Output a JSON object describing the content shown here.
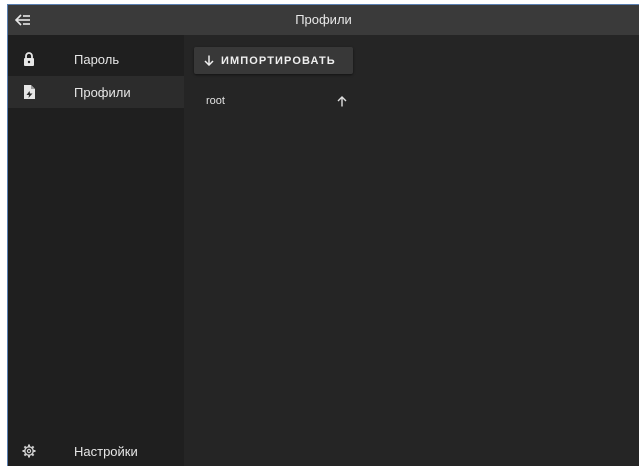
{
  "appbar": {
    "title": "Профили",
    "back_icon": "arrow-collapse-left-icon"
  },
  "sidebar": {
    "items": [
      {
        "label": "Пароль",
        "icon": "lock-icon"
      },
      {
        "label": "Профили",
        "icon": "file-icon",
        "active": true
      }
    ],
    "footer": {
      "label": "Настройки",
      "icon": "gear-icon"
    }
  },
  "main": {
    "import_button": {
      "label": "ИМПОРТИРОВАТЬ",
      "icon": "arrow-down-icon"
    },
    "profiles": [
      {
        "name": "root",
        "action_icon": "arrow-up-icon"
      }
    ]
  },
  "colors": {
    "appbar_bg": "#3a3a3a",
    "sidebar_bg": "#1f1f1f",
    "main_bg": "#252525",
    "button_bg": "#383838",
    "text": "#e6e6e6"
  }
}
